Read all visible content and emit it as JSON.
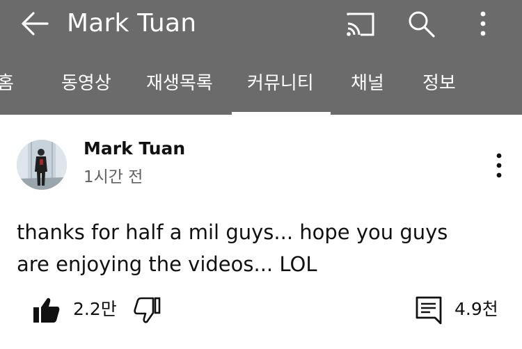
{
  "header": {
    "title": "Mark Tuan",
    "icons": [
      "back-arrow-icon",
      "cast-icon",
      "search-icon",
      "more-vert-icon"
    ]
  },
  "tabs": [
    {
      "label": "홈"
    },
    {
      "label": "동영상"
    },
    {
      "label": "재생목록"
    },
    {
      "label": "커뮤니티",
      "active": true
    },
    {
      "label": "채널"
    },
    {
      "label": "정보"
    }
  ],
  "post": {
    "author": "Mark Tuan",
    "time": "1시간 전",
    "text_line1": "thanks for half a mil guys... hope you guys",
    "text_line2": "are enjoying the videos... LOL",
    "likes": "2.2만",
    "comments": "4.9천"
  },
  "colors": {
    "appbar": "#6b6b6b",
    "text": "#111111",
    "secondary_text": "#606060"
  }
}
